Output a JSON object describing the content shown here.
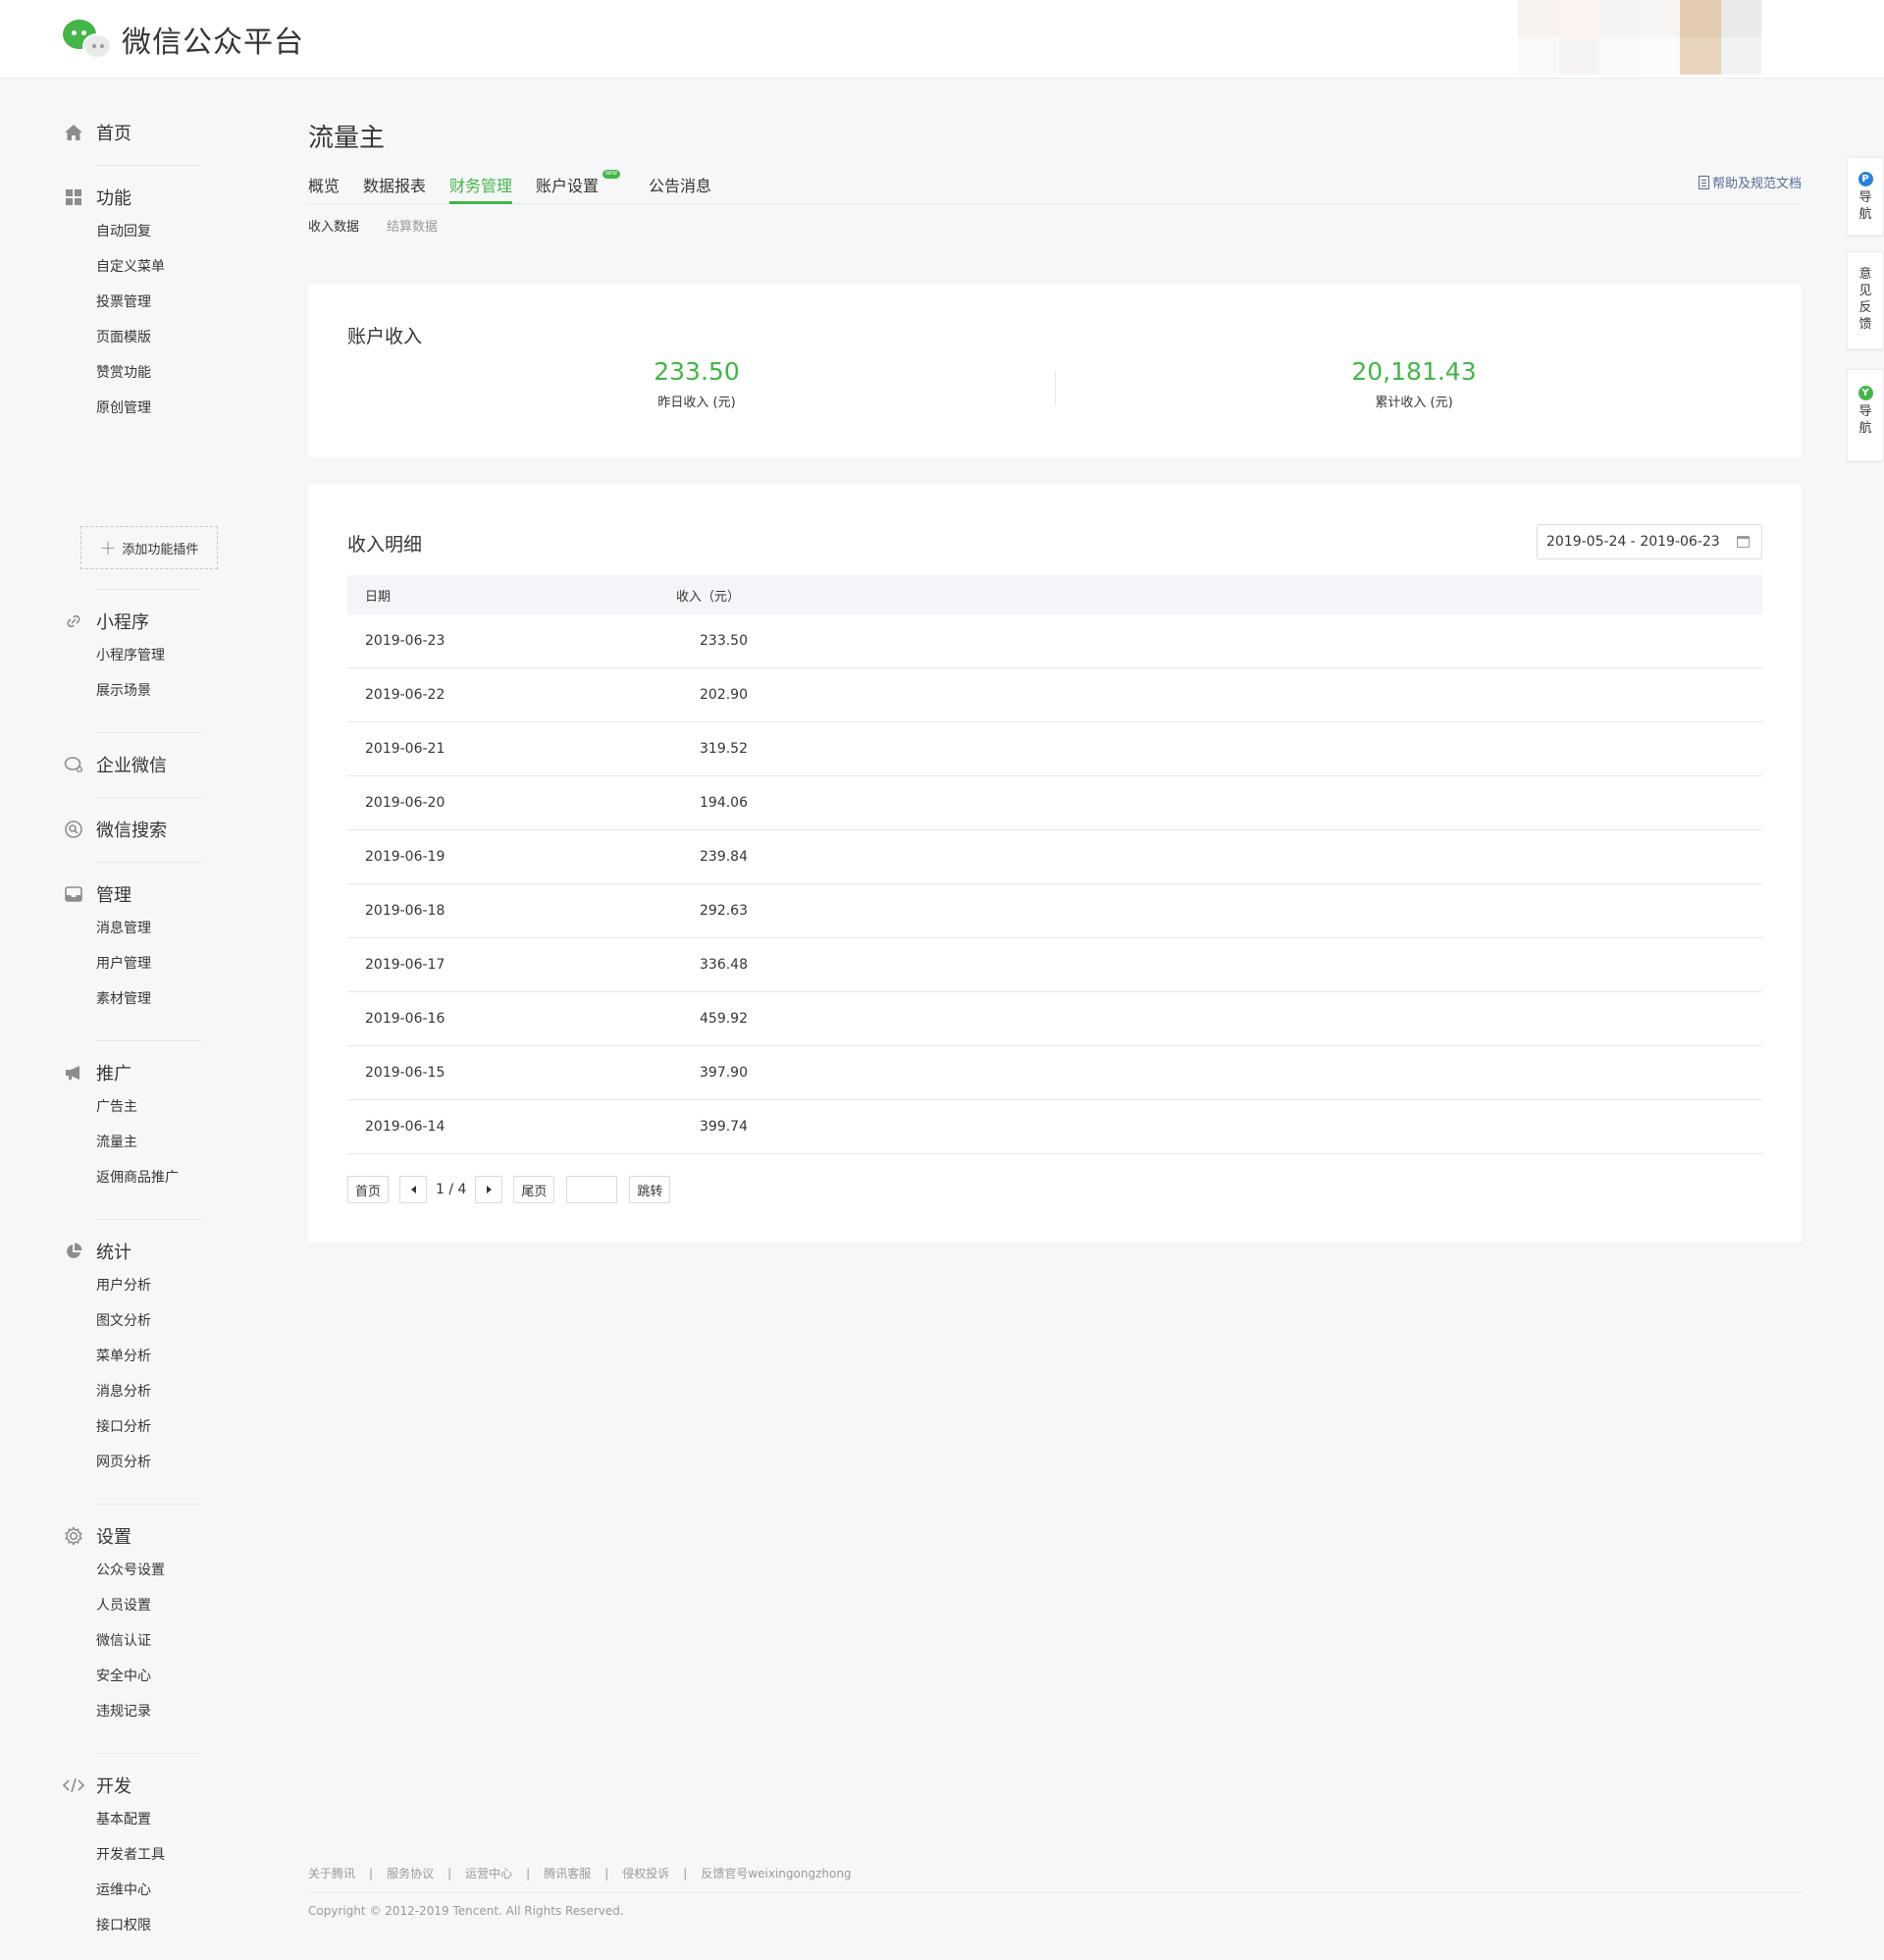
{
  "header": {
    "logo_text": "微信公众平台",
    "brand_color": "#44b549",
    "avatar_blur_colors": [
      "#ffffff",
      "#f7f3f1",
      "#fbf3f0",
      "#f4f4f4",
      "#f6f5f3",
      "#e3ccb0",
      "#eaeaea",
      "#ffffff",
      "#ffffff",
      "#fbfafa",
      "#f6f4f3",
      "#fafafa",
      "#fbfbfb",
      "#e8d4bd",
      "#f2f2f2",
      "#ffffff"
    ]
  },
  "sidebar": {
    "home": "首页",
    "features": {
      "label": "功能",
      "items": [
        "自动回复",
        "自定义菜单",
        "投票管理",
        "页面模版",
        "赞赏功能",
        "原创管理"
      ]
    },
    "add_plugin": "添加功能插件",
    "miniprogram": {
      "label": "小程序",
      "items": [
        "小程序管理",
        "展示场景"
      ]
    },
    "wework": "企业微信",
    "wxsearch": "微信搜索",
    "manage": {
      "label": "管理",
      "items": [
        "消息管理",
        "用户管理",
        "素材管理"
      ]
    },
    "promote": {
      "label": "推广",
      "items": [
        "广告主",
        "流量主",
        "返佣商品推广"
      ]
    },
    "stats": {
      "label": "统计",
      "items": [
        "用户分析",
        "图文分析",
        "菜单分析",
        "消息分析",
        "接口分析",
        "网页分析"
      ]
    },
    "settings": {
      "label": "设置",
      "items": [
        "公众号设置",
        "人员设置",
        "微信认证",
        "安全中心",
        "违规记录"
      ]
    },
    "dev": {
      "label": "开发",
      "items": [
        "基本配置",
        "开发者工具",
        "运维中心",
        "接口权限"
      ]
    }
  },
  "main": {
    "title": "流量主",
    "tabs": [
      "概览",
      "数据报表",
      "财务管理",
      "账户设置",
      "公告消息"
    ],
    "active_tab": "财务管理",
    "new_badge": "NEW",
    "help_link": "帮助及规范文档",
    "subtabs": [
      "收入数据",
      "结算数据"
    ],
    "account_income": {
      "title": "账户收入",
      "yesterday_value": "233.50",
      "yesterday_label": "昨日收入 (元)",
      "total_value": "20,181.43",
      "total_label": "累计收入 (元)"
    },
    "detail": {
      "title": "收入明细",
      "date_range": "2019-05-24 - 2019-06-23",
      "columns": [
        "日期",
        "收入（元）"
      ],
      "rows": [
        [
          "2019-06-23",
          "233.50"
        ],
        [
          "2019-06-22",
          "202.90"
        ],
        [
          "2019-06-21",
          "319.52"
        ],
        [
          "2019-06-20",
          "194.06"
        ],
        [
          "2019-06-19",
          "239.84"
        ],
        [
          "2019-06-18",
          "292.63"
        ],
        [
          "2019-06-17",
          "336.48"
        ],
        [
          "2019-06-16",
          "459.92"
        ],
        [
          "2019-06-15",
          "397.90"
        ],
        [
          "2019-06-14",
          "399.74"
        ]
      ],
      "pager": {
        "first": "首页",
        "page": "1 / 4",
        "last": "尾页",
        "jump": "跳转"
      }
    }
  },
  "footer": {
    "links": [
      "关于腾讯",
      "服务协议",
      "运营中心",
      "腾讯客服",
      "侵权投诉",
      "反馈官号weixingongzhong"
    ],
    "copyright": "Copyright © 2012-2019 Tencent. All Rights Reserved."
  },
  "float": {
    "nav1_icon": "P",
    "nav1_chars": [
      "导",
      "航"
    ],
    "feedback_chars": [
      "意",
      "见",
      "反",
      "馈"
    ],
    "nav2_icon": "Y",
    "nav2_chars": [
      "导",
      "航"
    ]
  }
}
